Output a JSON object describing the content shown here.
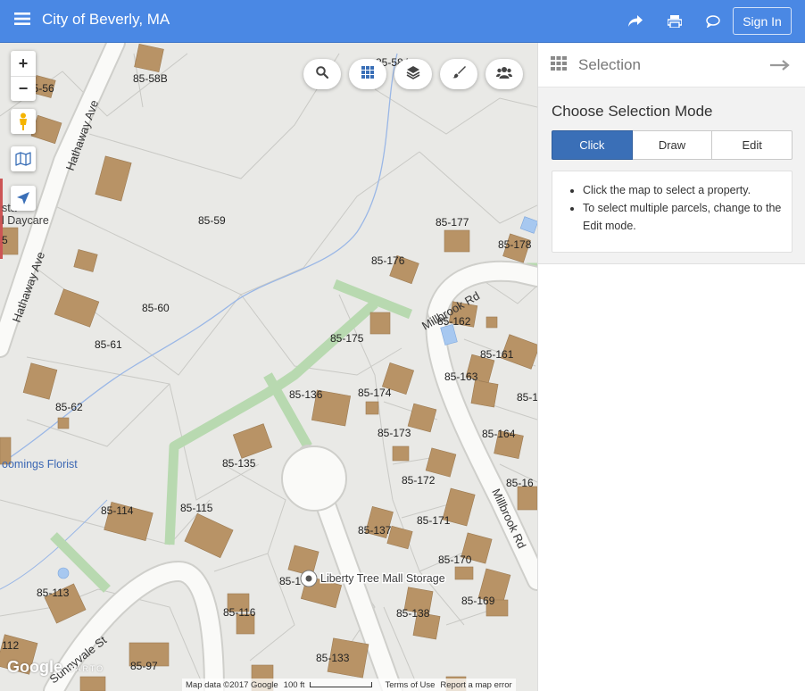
{
  "header": {
    "menu_icon": "hamburger-icon",
    "title": "City of Beverly, MA",
    "share_icon": "share-icon",
    "print_icon": "print-icon",
    "comment_icon": "comment-icon",
    "signin_label": "Sign In",
    "color": "#4a88e4"
  },
  "map": {
    "controls": {
      "zoom_in": "+",
      "zoom_out": "−",
      "pegman_icon": "pegman-icon",
      "basemap_icon": "map-icon",
      "locate_icon": "locate-icon"
    },
    "toolbar": [
      "search-icon",
      "grid-icon",
      "layers-icon",
      "paint-brush-icon",
      "users-icon"
    ],
    "parcels": [
      "85-58B",
      "85-56",
      "85-584",
      "85-59",
      "85-60",
      "85-61",
      "85-62",
      "85-177",
      "85-178",
      "85-176",
      "85-175",
      "85-162",
      "85-161",
      "85-163",
      "85-136",
      "85-174",
      "85-173",
      "85-164",
      "85-135",
      "85-172",
      "85-16",
      "85-171",
      "85-114",
      "85-115",
      "85-137",
      "85-170",
      "85-113",
      "85-169",
      "85-116",
      "85-1",
      "85-138",
      "85-133",
      "85-97",
      "112",
      "5",
      "85-1"
    ],
    "streets": [
      "Hathaway Ave",
      "Hathaway Ave",
      "Millbrook Rd",
      "Millbrook Rd",
      "Sunnyvale St"
    ],
    "pois": {
      "daycare": "l Daycare",
      "florist": "oomings Florist",
      "storage": "Liberty Tree Mall Storage",
      "sta": "sta"
    },
    "attribution": {
      "data": "Map data ©2017 Google",
      "scale": "100 ft",
      "terms": "Terms of Use",
      "report": "Report a map error",
      "google": "Google",
      "carto": "CARTO"
    }
  },
  "panel": {
    "icon": "grid-icon",
    "title": "Selection",
    "collapse_icon": "arrow-right-icon",
    "mode_title": "Choose Selection Mode",
    "modes": [
      "Click",
      "Draw",
      "Edit"
    ],
    "active_mode": "Click",
    "instructions": [
      "Click the map to select a property.",
      "To select multiple parcels, change to the Edit mode."
    ]
  }
}
